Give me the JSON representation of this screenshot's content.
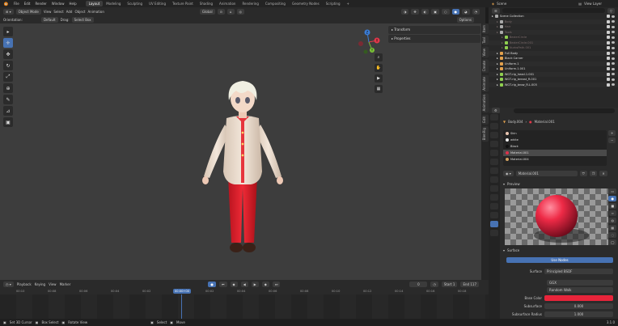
{
  "top_menu": {
    "items": [
      "File",
      "Edit",
      "Render",
      "Window",
      "Help"
    ],
    "workspaces": [
      "Layout",
      "Modeling",
      "Sculpting",
      "UV Editing",
      "Texture Paint",
      "Shading",
      "Animation",
      "Rendering",
      "Compositing",
      "Geometry Nodes",
      "Scripting"
    ],
    "active_workspace": "Layout",
    "add_tab": "+",
    "scene_label": "Scene",
    "view_layer_label": "View Layer"
  },
  "viewport_header": {
    "mode": "Object Mode",
    "menus": [
      "View",
      "Select",
      "Add",
      "Object",
      "Animation"
    ],
    "transform_orientation": "Global",
    "options_label": "Options"
  },
  "viewport_header2": {
    "orientation_label": "Orientation:",
    "orientation_value": "Default",
    "drag_label": "Drag:",
    "drag_value": "Select Box"
  },
  "npanel": {
    "sections": [
      "Transform",
      "Properties"
    ],
    "tabs": [
      "Item",
      "Tool",
      "View",
      "Create",
      "Animate",
      "Animation",
      "Edit",
      "BlenRig"
    ]
  },
  "gizmo": {
    "x": "X",
    "y": "Y",
    "z": "Z"
  },
  "outliner": {
    "title": "Scene Collection",
    "rows": [
      {
        "name": "Scene Collection",
        "indent": 0,
        "color": "#aaaaaa",
        "dim": false
      },
      {
        "name": "Body",
        "indent": 1,
        "color": "#aaaaaa",
        "dim": true
      },
      {
        "name": "Hair",
        "indent": 1,
        "color": "#aaaaaa",
        "dim": true
      },
      {
        "name": "Tools",
        "indent": 1,
        "color": "#aaaaaa",
        "dim": true
      },
      {
        "name": "BezierCircle",
        "indent": 2,
        "color": "#8fcf4f",
        "dim": true
      },
      {
        "name": "BezierCircle.001",
        "indent": 2,
        "color": "#8fcf4f",
        "dim": true
      },
      {
        "name": "NurbsPath.001",
        "indent": 2,
        "color": "#8fcf4f",
        "dim": true
      },
      {
        "name": "Full Body",
        "indent": 1,
        "color": "#e3a14d",
        "dim": false
      },
      {
        "name": "Black Carver",
        "indent": 1,
        "color": "#e3a14d",
        "dim": false
      },
      {
        "name": "Uniform.1",
        "indent": 1,
        "color": "#e3a14d",
        "dim": false
      },
      {
        "name": "Uniform.1.001",
        "indent": 1,
        "color": "#e3a14d",
        "dim": false
      },
      {
        "name": "WGT-rig_head.1.001",
        "indent": 1,
        "color": "#8fcf4f",
        "dim": false
      },
      {
        "name": "WGT-rig_breast_R.001",
        "indent": 1,
        "color": "#8fcf4f",
        "dim": false
      },
      {
        "name": "WGT-rig_brow_R.L.005",
        "indent": 1,
        "color": "#8fcf4f",
        "dim": false
      }
    ]
  },
  "properties": {
    "search_placeholder": "",
    "breadcrumb_object": "Body.004",
    "breadcrumb_material": "Material.001",
    "material_slots": [
      {
        "name": "Skin",
        "color": "#e8c5b0"
      },
      {
        "name": "white",
        "color": "#eeeeee"
      },
      {
        "name": "Black",
        "color": "#111111"
      },
      {
        "name": "Material.001",
        "color": "#e0304a"
      },
      {
        "name": "Material.004",
        "color": "#d0a060"
      }
    ],
    "active_slot": 3,
    "material_name": "Material.001",
    "preview_label": "Preview",
    "surface_label": "Surface",
    "use_nodes_label": "Use Nodes",
    "surface_field_label": "Surface",
    "surface_value": "Principled BSDF",
    "distribution_value": "GGX",
    "subsurface_method_value": "Random Walk",
    "base_color_label": "Base Color",
    "base_color": "#e8243a",
    "subsurface_label": "Subsurface",
    "subsurface_value": "0.000",
    "subsurface_radius_label": "Subsurface Radius",
    "subsurface_radius_value": "1.000"
  },
  "timeline_header": {
    "menus": [
      "Playback",
      "Keying",
      "View",
      "Marker"
    ],
    "current_frame": "0",
    "start_label": "Start",
    "start_value": "1",
    "end_label": "End",
    "end_value": "117"
  },
  "timeline": {
    "ticks": [
      "00:10",
      "00:08",
      "00:06",
      "00:04",
      "00:02",
      "00:00+00",
      "00:02",
      "00:04",
      "00:06",
      "00:08",
      "00:10",
      "00:12",
      "00:14",
      "00:16",
      "00:18"
    ],
    "current_label": "00:00+00"
  },
  "statusbar": {
    "items": [
      "Set 3D Cursor",
      "Box Select",
      "Rotate View",
      "Select",
      "Move"
    ],
    "version": "3.1.0"
  },
  "colors": {
    "accent": "#4772b3",
    "viewport_bg": "#3d3d3d",
    "panel_bg": "#2b2b2b"
  }
}
